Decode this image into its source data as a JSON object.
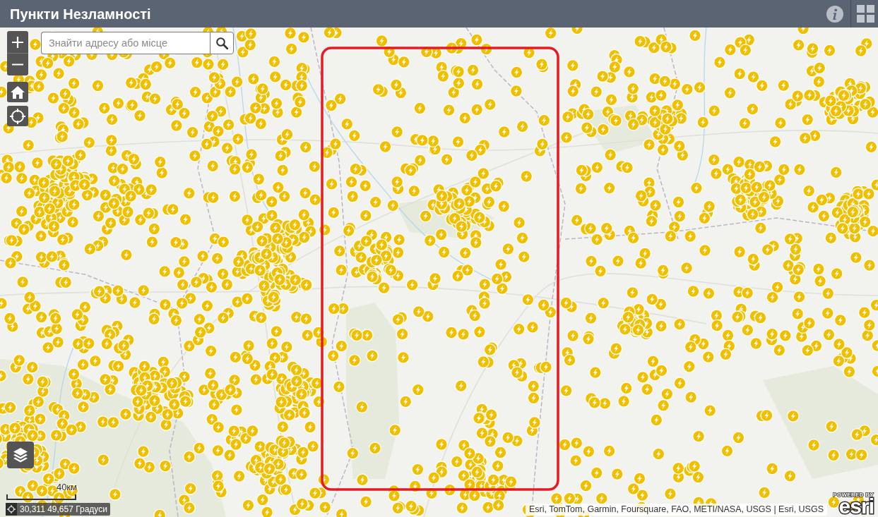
{
  "header": {
    "title": "Пункти Незламності"
  },
  "search": {
    "placeholder": "Знайти адресу або місце"
  },
  "scale": {
    "label": "40км"
  },
  "coordinates": {
    "text": "30,311 49,657 Градуси"
  },
  "attribution": "Esri, TomTom, Garmin, Foursquare, FAO, METI/NASA, USGS | Esri, USGS",
  "logo": {
    "caption": "POWERED BY",
    "wordmark": "esri"
  }
}
